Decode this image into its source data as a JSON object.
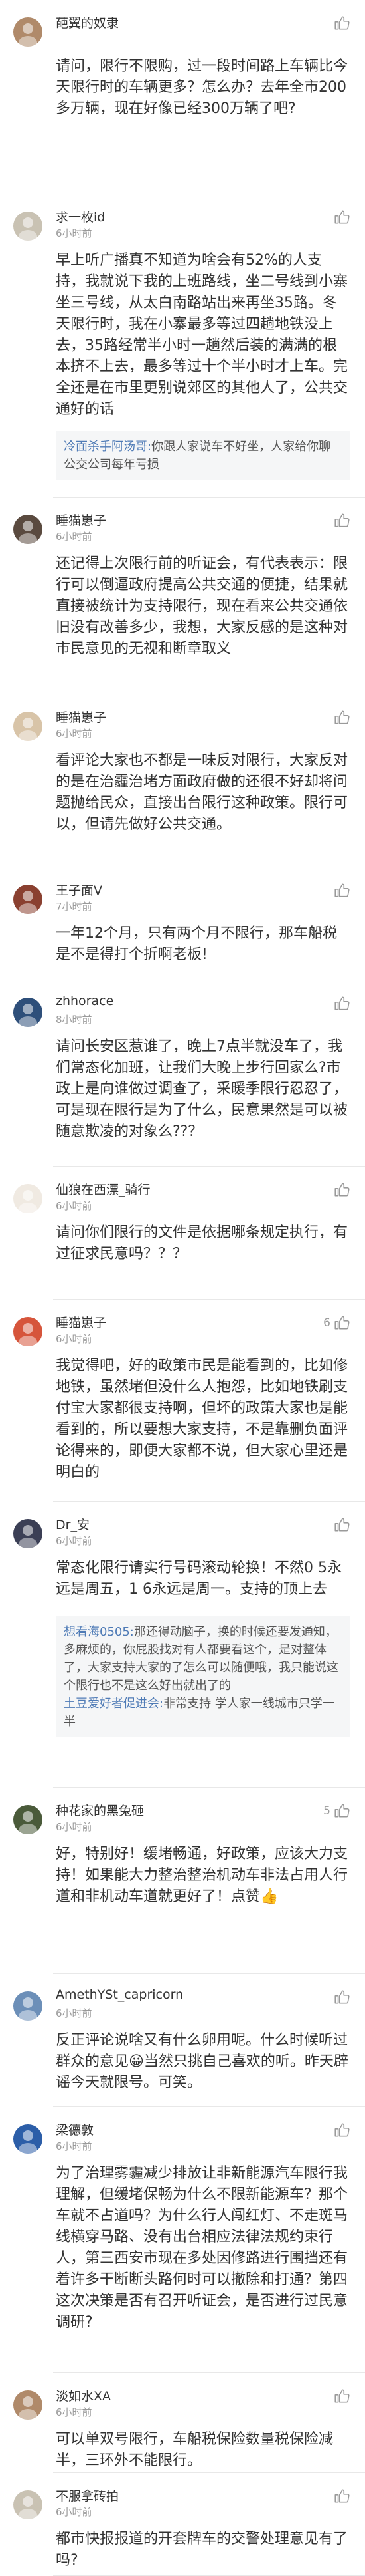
{
  "comments": [
    {
      "user": "葩翼的奴隶",
      "time": "",
      "likes": "",
      "text": "请问，限行不限购，过一段时间路上车辆比今天限行时的车辆更多？怎么办？去年全市200多万辆，现在好像已经300万辆了吧?",
      "avatar": "avatar-user-1",
      "replies": []
    },
    {
      "user": "求一枚id",
      "time": "6小时前",
      "likes": "",
      "text": "早上听广播真不知道为啥会有52%的人支持，我就说下我的上班路线，坐二号线到小寨坐三号线，从太白南路站出来再坐35路。冬天限行时，我在小寨最多等过四趟地铁没上去，35路经常半小时一趟然后装的满满的根本挤不上去，最多等过十个半小时才上车。完全还是在市里更别说郊区的其他人了，公共交通好的话",
      "avatar": "avatar-user-2",
      "replies": [
        {
          "name": "冷面杀手阿汤哥:",
          "text": "你跟人家说车不好坐，人家给你聊公交公司每年亏损"
        }
      ]
    },
    {
      "user": "睡猫崽子",
      "time": "6小时前",
      "likes": "",
      "text": "还记得上次限行前的听证会，有代表表示：限行可以倒逼政府提高公共交通的便捷，结果就直接被统计为支持限行，现在看来公共交通依旧没有改善多少，我想，大家反感的是这种对市民意见的无视和断章取义",
      "avatar": "avatar-user-3",
      "replies": []
    },
    {
      "user": "睡猫崽子",
      "time": "6小时前",
      "likes": "",
      "text": "看评论大家也不都是一味反对限行，大家反对的是在治霾治堵方面政府做的还很不好却将问题抛给民众，直接出台限行这种政策。限行可以，但请先做好公共交通。",
      "avatar": "avatar-user-3",
      "replies": []
    },
    {
      "user": "王子面V",
      "time": "7小时前",
      "likes": "",
      "text": "一年12个月，只有两个月不限行，那车船税是不是得打个折啊老板!",
      "avatar": "avatar-user-4",
      "replies": []
    },
    {
      "user": "zhhorace",
      "time": "8小时前",
      "likes": "",
      "text": "请问长安区惹谁了，晚上7点半就没车了，我们常态化加班，让我们大晚上步行回家么?市政上是向谁做过调查了，采暖季限行忍忍了，可是现在限行是为了什么，民意果然是可以被随意欺凌的对象么??？",
      "avatar": "avatar-user-5",
      "replies": []
    },
    {
      "user": "仙狼在西漂_骑行",
      "time": "6小时前",
      "likes": "",
      "text": "请问你们限行的文件是依据哪条规定执行，有过征求民意吗？？？",
      "avatar": "avatar-user-6",
      "replies": []
    },
    {
      "user": "睡猫崽子",
      "time": "6小时前",
      "likes": "6",
      "text": "我觉得吧，好的政策市民是能看到的，比如修地铁，虽然堵但没什么人抱怨，比如地铁刷支付宝大家都很支持啊，但坏的政策大家也是能看到的，所以要想大家支持，不是靠删负面评论得来的，即便大家都不说，但大家心里还是明白的",
      "avatar": "avatar-user-3",
      "replies": []
    },
    {
      "user": "Dr_安",
      "time": "6小时前",
      "likes": "",
      "text": "常态化限行请实行号码滚动轮换！不然0 5永远是周五，1 6永远是周一。支持的顶上去",
      "avatar": "avatar-user-7",
      "replies": [
        {
          "name": "想看海0505:",
          "text": "那还得动脑子，换的时候还要发通知，多麻烦的，你屁股找对有人都要看这个，是对整体了，大家支持大家的了怎么可以随便哦，我只能说这个限行也不是这么好出就出了的"
        },
        {
          "name": "土豆爱好者促进会:",
          "text": "非常支持 学人家一线城市只学一半"
        }
      ]
    },
    {
      "user": "种花家的黑兔砸",
      "time": "6小时前",
      "likes": "5",
      "text": "好，特别好！缓堵畅通，好政策，应该大力支持！如果能大力整治整治机动车非法占用人行道和非机动车道就更好了！点赞👍",
      "avatar": "avatar-user-8",
      "replies": []
    },
    {
      "user": "AmethYSt_capricorn",
      "time": "6小时前",
      "likes": "",
      "text": "反正评论说啥又有什么卵用呢。什么时候听过群众的意见😀当然只挑自己喜欢的听。昨天辟谣今天就限号。可笑。",
      "avatar": "avatar-user-9",
      "replies": []
    },
    {
      "user": "梁德敦",
      "time": "6小时前",
      "likes": "",
      "text": "为了治理雾霾减少排放让非新能源汽车限行我理解，但缓堵保畅为什么不限新能源车？那个车就不占道吗？为什么行人闯红灯、不走斑马线横穿马路、没有出台相应法律法规约束行人，第三西安市现在多处因修路进行围挡还有着许多干断断头路何时可以撤除和打通？第四这次决策是否有召开听证会，是否进行过民意调研?",
      "avatar": "avatar-user-10",
      "replies": []
    },
    {
      "user": "淡如水XA",
      "time": "6小时前",
      "likes": "",
      "text": "可以单双号限行，车船税保险数量税保险减半，三环外不能限行。",
      "avatar": "avatar-user-11",
      "replies": []
    },
    {
      "user": "不服拿砖拍",
      "time": "6小时前",
      "likes": "",
      "text": "都市快报报道的开套牌车的交警处理意见有了吗?",
      "avatar": "avatar-user-12",
      "replies": []
    }
  ],
  "icon_names": {
    "like": "thumbs-up-icon"
  },
  "colors": {
    "text": "#333333",
    "meta": "#9a9a9a",
    "reply_name": "#4f7bb6",
    "reply_bg": "#f5f6f7",
    "divider": "#e8e8e8"
  }
}
